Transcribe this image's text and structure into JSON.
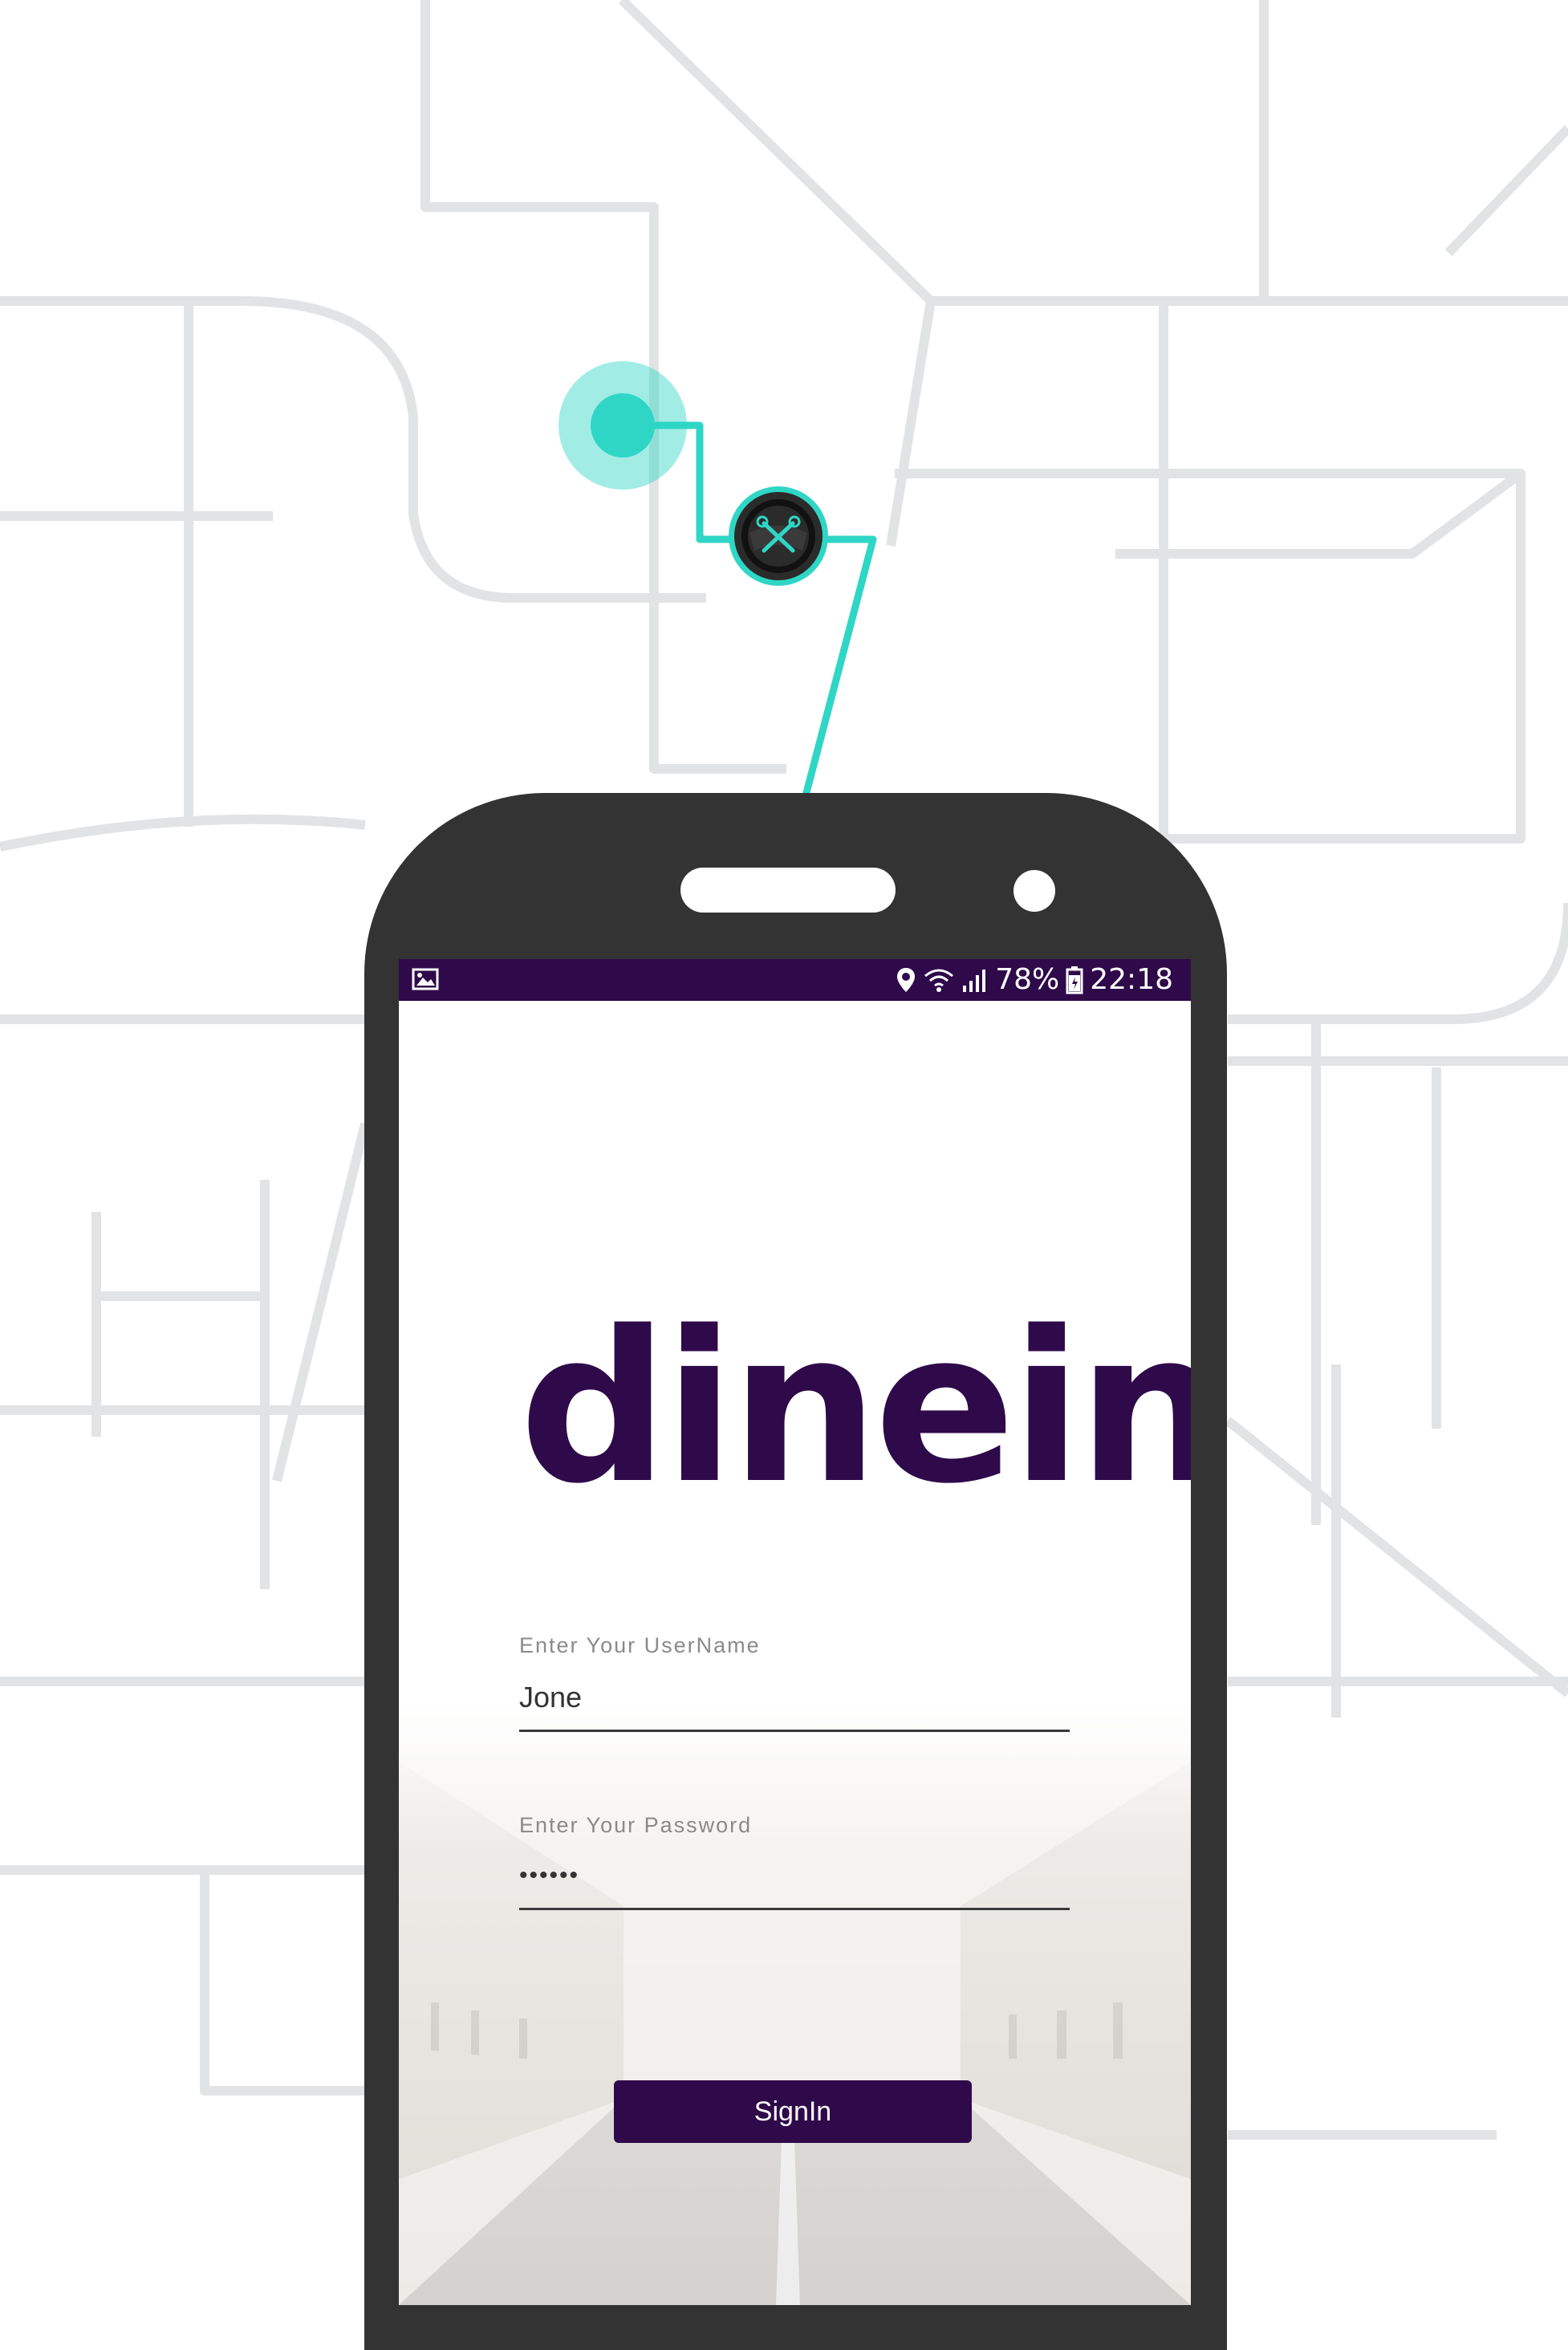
{
  "status_bar": {
    "battery": "78%",
    "time": "22:18",
    "background_color": "#2f0a4a"
  },
  "logo": {
    "text": "dinein",
    "color": "#2f0a4a"
  },
  "login_form": {
    "username": {
      "label": "Enter Your UserName",
      "value": "Jone"
    },
    "password": {
      "label": "Enter Your Password",
      "value": "••••••"
    },
    "signin_label": "SignIn"
  },
  "colors": {
    "brand": "#2f0a4a",
    "route": "#2fd6c5",
    "map_lines": "#e2e3e5",
    "phone_body": "#333333"
  },
  "icons": [
    "gallery-icon",
    "location-icon",
    "wifi-icon",
    "signal-icon",
    "battery-icon",
    "steering-wheel-icon"
  ]
}
